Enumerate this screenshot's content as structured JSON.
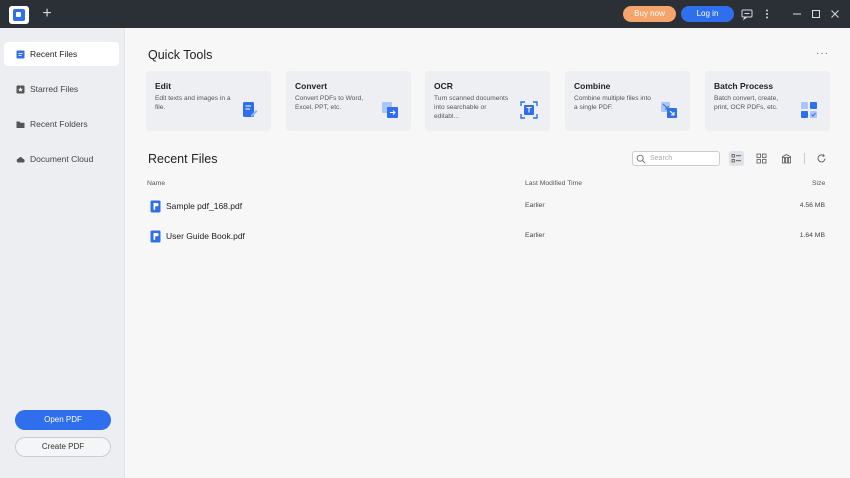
{
  "titlebar": {
    "new_tab": "+",
    "buy_label": "Buy now",
    "login_label": "Log in",
    "colors": {
      "bar": "#2b2f36",
      "buy": "#f5a56b",
      "login": "#2f6fed"
    }
  },
  "sidebar": {
    "items": [
      {
        "label": "Recent Files",
        "icon": "recent-files-icon",
        "active": true
      },
      {
        "label": "Starred Files",
        "icon": "star-icon",
        "active": false
      },
      {
        "label": "Recent Folders",
        "icon": "folder-icon",
        "active": false
      },
      {
        "label": "Document Cloud",
        "icon": "cloud-icon",
        "active": false
      }
    ],
    "open_label": "Open PDF",
    "create_label": "Create PDF"
  },
  "quick_tools": {
    "title": "Quick Tools",
    "more": "···",
    "cards": [
      {
        "title": "Edit",
        "desc": "Edit texts and images in a file.",
        "icon": "edit-icon"
      },
      {
        "title": "Convert",
        "desc": "Convert PDFs to Word, Excel, PPT, etc.",
        "icon": "convert-icon"
      },
      {
        "title": "OCR",
        "desc": "Turn scanned documents into searchable or editabl...",
        "icon": "ocr-icon"
      },
      {
        "title": "Combine",
        "desc": "Combine multiple files into a single PDF.",
        "icon": "combine-icon"
      },
      {
        "title": "Batch Process",
        "desc": "Batch convert, create, print, OCR PDFs, etc.",
        "icon": "batch-icon"
      }
    ]
  },
  "recent": {
    "title": "Recent Files",
    "search_placeholder": "Search",
    "columns": {
      "name": "Name",
      "modified": "Last Modified Time",
      "size": "Size"
    },
    "files": [
      {
        "name": "Sample pdf_168.pdf",
        "modified": "Earlier",
        "size": "4.56 MB"
      },
      {
        "name": "User Guide Book.pdf",
        "modified": "Earlier",
        "size": "1.64 MB"
      }
    ]
  }
}
